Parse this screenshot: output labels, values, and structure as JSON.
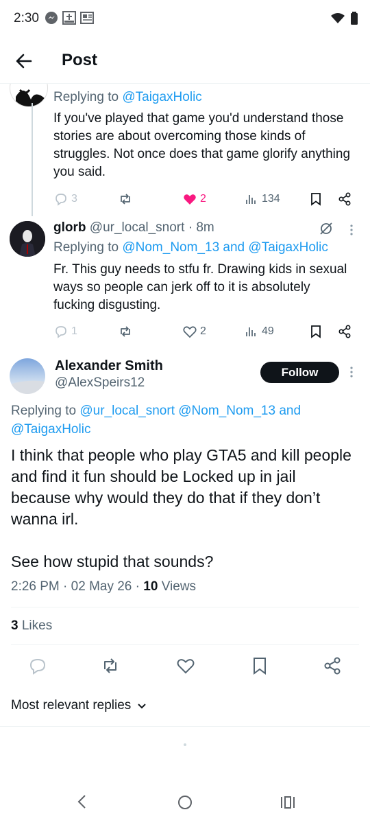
{
  "status_bar": {
    "time": "2:30"
  },
  "header": {
    "title": "Post"
  },
  "reply1": {
    "replying_prefix": "Replying to",
    "replying_to": "@TaigaxHolic",
    "text": "If you've played that game you'd understand those stories are about overcoming those kinds of struggles. Not once does that game glorify anything you said.",
    "replies": "3",
    "likes": "2",
    "views": "134"
  },
  "reply2": {
    "name": "glorb",
    "handle": "@ur_local_snort",
    "time": "8m",
    "replying_prefix": "Replying to",
    "replying_to_1": "@Nom_Nom_13",
    "replying_and": "and",
    "replying_to_2": "@TaigaxHolic",
    "text": "Fr. This guy needs to stfu fr. Drawing kids in sexual ways so people can jerk off to it is absolutely fucking disgusting.",
    "replies": "1",
    "likes": "2",
    "views": "49"
  },
  "main_post": {
    "name": "Alexander Smith",
    "handle": "@AlexSpeirs12",
    "follow_label": "Follow",
    "replying_prefix": "Replying to",
    "replying_to_1": "@ur_local_snort",
    "replying_to_2": "@Nom_Nom_13",
    "replying_and": "and",
    "replying_to_3": "@TaigaxHolic",
    "text_p1": "I think that people who play GTA5 and kill people and find it fun should be Locked up in jail because why would they do that if they don’t wanna irl.",
    "text_p2": "See how stupid that sounds?",
    "time": "2:26 PM",
    "date": "02 May 26",
    "views_count": "10",
    "views_label": "Views",
    "likes_count": "3",
    "likes_label": "Likes"
  },
  "sort": {
    "label": "Most relevant replies"
  },
  "colors": {
    "accent": "#1d9bf0",
    "like": "#f91880",
    "text": "#0f1419",
    "secondary": "#536471"
  }
}
